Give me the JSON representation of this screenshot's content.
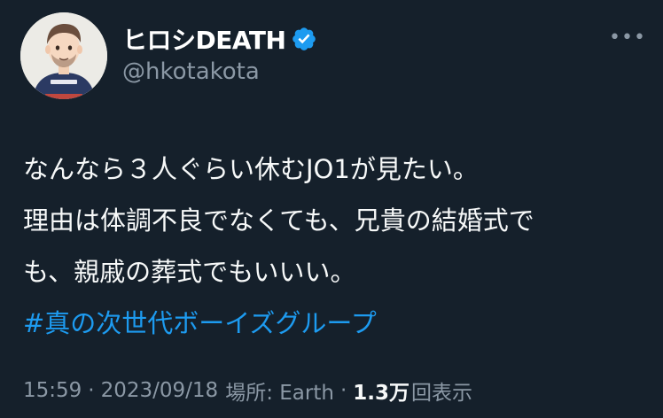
{
  "tweet": {
    "author": {
      "display_name": "ヒロシDEATH",
      "handle": "@hkotakota",
      "verified": true,
      "avatar_icon": "avatar-illustration"
    },
    "more_icon": "more-horizontal-icon",
    "more_label": "•••",
    "body_lines": [
      "なんなら３人ぐらい休むJO1が見たい。",
      "理由は体調不良でなくても、兄貴の結婚式で",
      "も、親戚の葬式でもいいい。"
    ],
    "hashtag": "#真の次世代ボーイズグループ",
    "meta": {
      "time": "15:59",
      "separator": "·",
      "date": "2023/09/18",
      "location": "場所: Earth",
      "views_count": "1.3万",
      "views_label": "回表示"
    }
  },
  "colors": {
    "background": "#15202b",
    "text_primary": "#f7f9f9",
    "text_secondary": "#8b98a5",
    "link": "#1d9bf0",
    "verified_badge": "#1d9bf0"
  }
}
